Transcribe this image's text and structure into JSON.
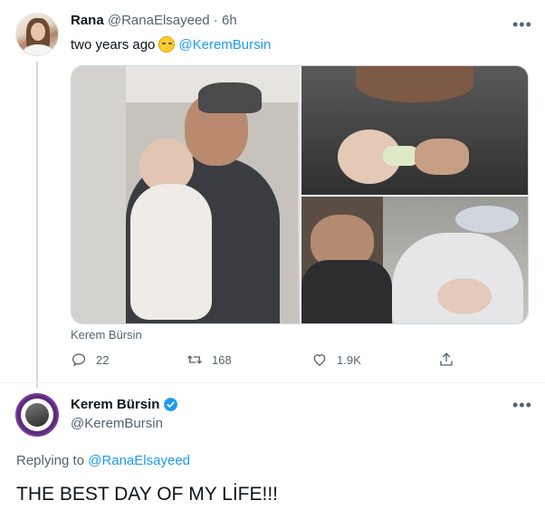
{
  "tweet": {
    "author_name": "Rana",
    "author_handle": "@RanaElsayeed",
    "separator": "·",
    "time": "6h",
    "text": "two years ago",
    "emoji": "relieved-face-emoji",
    "mention": "@KeremBursin",
    "tagged_person": "Kerem Bürsin",
    "stats": {
      "replies": "22",
      "retweets": "168",
      "likes": "1.9K"
    },
    "icons": {
      "reply": "reply-icon",
      "retweet": "retweet-icon",
      "like": "heart-icon",
      "share": "share-icon",
      "more": "more-options-icon"
    }
  },
  "reply": {
    "author_name": "Kerem Bürsin",
    "author_handle": "@KeremBursin",
    "verified": true,
    "replying_prefix": "Replying to",
    "replying_to": "@RanaElsayeed",
    "text": "THE BEST DAY OF MY LİFE!!!"
  },
  "colors": {
    "link": "#1d9bf0",
    "secondary_text": "#536471",
    "primary_text": "#0f1419",
    "verified": "#1d9bf0",
    "thread_line": "#cfd9de"
  }
}
